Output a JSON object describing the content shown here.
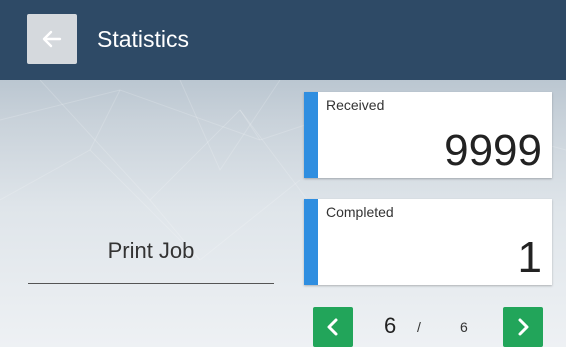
{
  "header": {
    "title": "Statistics",
    "back_icon": "arrow-left-icon"
  },
  "counters": [
    {
      "label": "Received",
      "value": "9999"
    },
    {
      "label": "Completed",
      "value": "1"
    }
  ],
  "category": {
    "label": "Print Job"
  },
  "pager": {
    "current": "6",
    "separator": "/",
    "total": "6",
    "prev_icon": "chevron-left-icon",
    "next_icon": "chevron-right-icon"
  },
  "colors": {
    "header_bg": "#2e4a66",
    "accent": "#2f8ee0",
    "pager_button": "#22a55a"
  }
}
